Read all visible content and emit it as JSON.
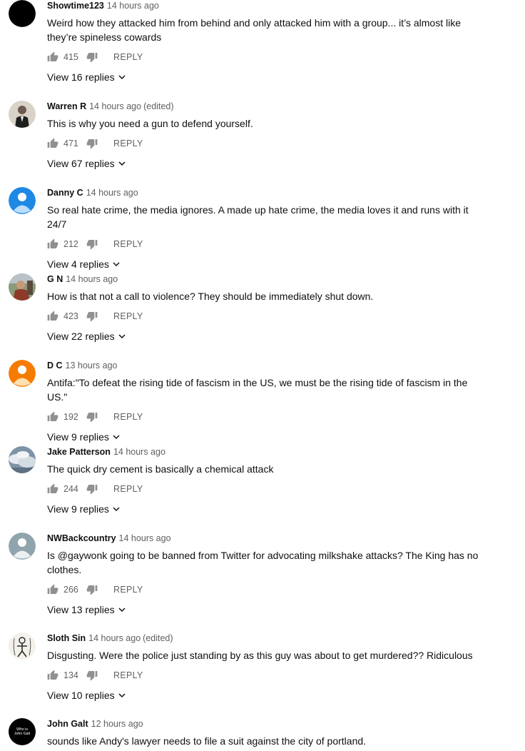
{
  "comments": [
    {
      "author": "Showtime123",
      "time": "14 hours ago",
      "edited": "",
      "text": "Weird how they attacked him from behind and only attacked him with a group... it’s almost like they’re spineless cowards",
      "likes": "415",
      "reply_label": "REPLY",
      "view_replies": "View 16 replies",
      "avatar": "black-circle"
    },
    {
      "author": "Warren R",
      "time": "14 hours ago",
      "edited": "(edited)",
      "text": "This is why you need a gun to defend yourself.",
      "likes": "471",
      "reply_label": "REPLY",
      "view_replies": "View 67 replies",
      "avatar": "photo-man-suit"
    },
    {
      "author": "Danny C",
      "time": "14 hours ago",
      "edited": "",
      "text": "So real hate crime, the media ignores. A made up hate crime, the media loves it and runs with it 24/7",
      "likes": "212",
      "reply_label": "REPLY",
      "view_replies": "View 4 replies",
      "avatar": "default-person-blue"
    },
    {
      "author": "G N",
      "time": "14 hours ago",
      "edited": "",
      "text": "How is that not a call to violence? They should be immediately shut down.",
      "likes": "423",
      "reply_label": "REPLY",
      "view_replies": "View 22 replies",
      "avatar": "photo-person-outdoor"
    },
    {
      "author": "D C",
      "time": "13 hours ago",
      "edited": "",
      "text": "Antifa:\"To defeat the rising tide of fascism in the US, we must be the rising tide of fascism in the US.\"",
      "likes": "192",
      "reply_label": "REPLY",
      "view_replies": "View 9 replies",
      "avatar": "default-person-orange"
    },
    {
      "author": "Jake Patterson",
      "time": "14 hours ago",
      "edited": "",
      "text": "The quick dry cement is basically a chemical attack",
      "likes": "244",
      "reply_label": "REPLY",
      "view_replies": "View 9 replies",
      "avatar": "photo-clouds"
    },
    {
      "author": "NWBackcountry",
      "time": "14 hours ago",
      "edited": "",
      "text": "Is @gaywonk going to be banned from Twitter for advocating milkshake attacks? The King has no clothes.",
      "likes": "266",
      "reply_label": "REPLY",
      "view_replies": "View 13 replies",
      "avatar": "default-person-grey"
    },
    {
      "author": "Sloth Sin",
      "time": "14 hours ago",
      "edited": "(edited)",
      "text": "Disgusting. Were the police just standing by as this guy was about to get murdered?? Ridiculous",
      "likes": "134",
      "reply_label": "REPLY",
      "view_replies": "View 10 replies",
      "avatar": "sketch-figure"
    },
    {
      "author": "John Galt",
      "time": "12 hours ago",
      "edited": "",
      "text": "sounds like Andy's lawyer needs to file a suit against the city of portland.",
      "likes": "",
      "reply_label": "",
      "view_replies": "",
      "avatar": "logo-who-is-john-galt",
      "avatar_text": [
        "Who is",
        "John Galt"
      ]
    }
  ],
  "icons": {
    "like": "thumbs-up-icon",
    "dislike": "thumbs-down-icon",
    "chevron": "chevron-down-icon"
  },
  "colors": {
    "text": "#0f0f0f",
    "secondary": "#606060",
    "icon": "#909090",
    "avatar_blue": "#1e88e5",
    "avatar_orange": "#f57c00",
    "avatar_grey": "#90a4ae"
  }
}
